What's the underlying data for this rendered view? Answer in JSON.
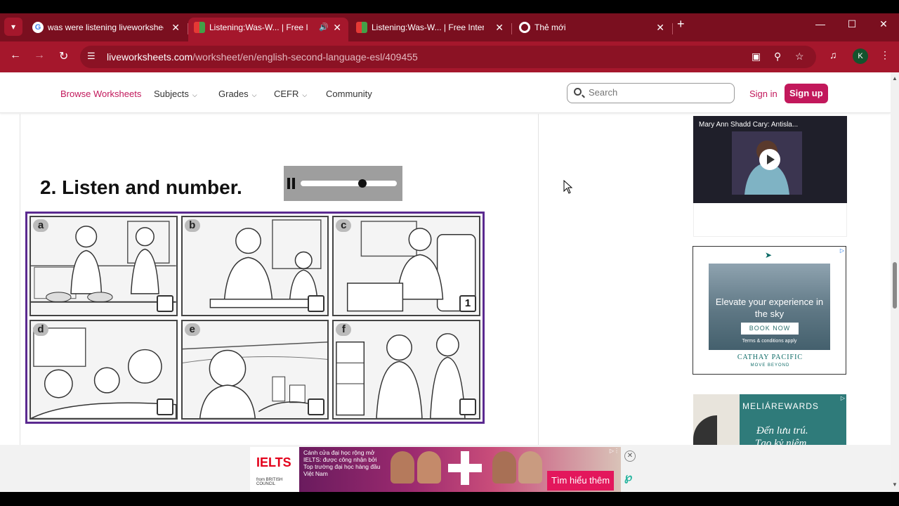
{
  "browser": {
    "tabs": [
      {
        "title": "was were listening liveworksheets",
        "active": false
      },
      {
        "title": "Listening:Was-W... | Free Interactive",
        "active": true
      },
      {
        "title": "Listening:Was-W... | Free Interactive",
        "active": false
      },
      {
        "title": "Thẻ mới",
        "active": false
      }
    ],
    "url_host": "liveworksheets.com",
    "url_path": "/worksheet/en/english-second-language-esl/409455",
    "profile_initial": "K",
    "tab_menu_icon": "chevron-down",
    "new_tab_icon": "plus",
    "window_controls": [
      "minimize",
      "maximize",
      "close"
    ]
  },
  "site": {
    "nav": {
      "browse": "Browse Worksheets",
      "subjects": "Subjects",
      "grades": "Grades",
      "cefr": "CEFR",
      "community": "Community"
    },
    "search_placeholder": "Search",
    "signin": "Sign in",
    "signup": "Sign up"
  },
  "worksheet": {
    "heading": "2. Listen and number.",
    "audio_progress": 0.64,
    "pictures": [
      {
        "letter": "a",
        "answer": ""
      },
      {
        "letter": "b",
        "answer": ""
      },
      {
        "letter": "c",
        "answer": "1"
      },
      {
        "letter": "d",
        "answer": ""
      },
      {
        "letter": "e",
        "answer": ""
      },
      {
        "letter": "f",
        "answer": ""
      }
    ]
  },
  "sidebar": {
    "video_title": "Mary Ann Shadd Cary: Antisla...",
    "ad1": {
      "headline": "Elevate your experience in the sky",
      "button": "BOOK NOW",
      "terms": "Terms & conditions apply",
      "brand": "CATHAY PACIFIC",
      "tagline": "MOVE BEYOND"
    },
    "ad2": {
      "brand": "MELIÁREWARDS",
      "line1": "Đến lưu trú.",
      "line2": "Tạo kỷ niệm"
    }
  },
  "bottom_ad": {
    "logo": "IELTS",
    "from": "from BRITISH COUNCIL",
    "text": "Cánh cửa đại học rộng mở IELTS: được công nhận bởi Top trường đại học hàng đầu Việt Nam",
    "cta": "Tìm hiểu thêm"
  },
  "colors": {
    "browser_tabbar": "#7a0f1f",
    "browser_toolbar": "#a5172c",
    "brand_pink": "#c2185b",
    "worksheet_border": "#5b2a90"
  }
}
